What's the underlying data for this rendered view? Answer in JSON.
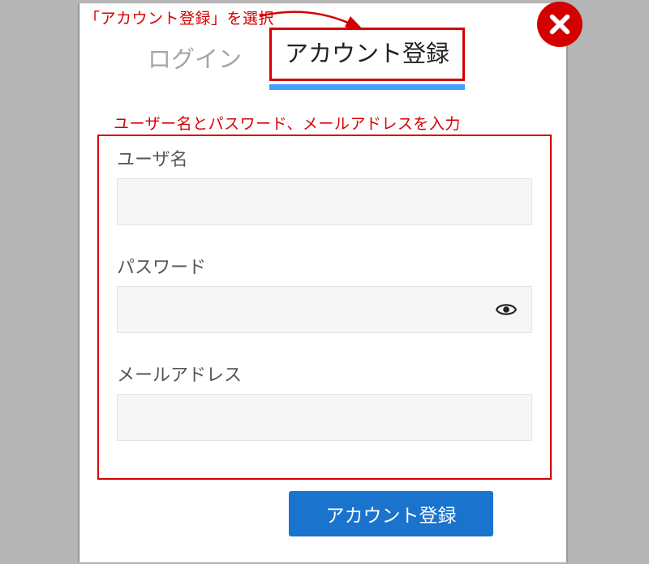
{
  "annotations": {
    "select_tab": "「アカウント登録」を選択",
    "enter_fields": "ユーザー名とパスワード、メールアドレスを入力"
  },
  "tabs": {
    "login": "ログイン",
    "register": "アカウント登録"
  },
  "form": {
    "username_label": "ユーザ名",
    "password_label": "パスワード",
    "email_label": "メールアドレス",
    "username_value": "",
    "password_value": "",
    "email_value": ""
  },
  "submit_label": "アカウント登録",
  "colors": {
    "annotation": "#d40000",
    "active_underline": "#3fa0ff",
    "button_bg": "#1a73cc"
  }
}
